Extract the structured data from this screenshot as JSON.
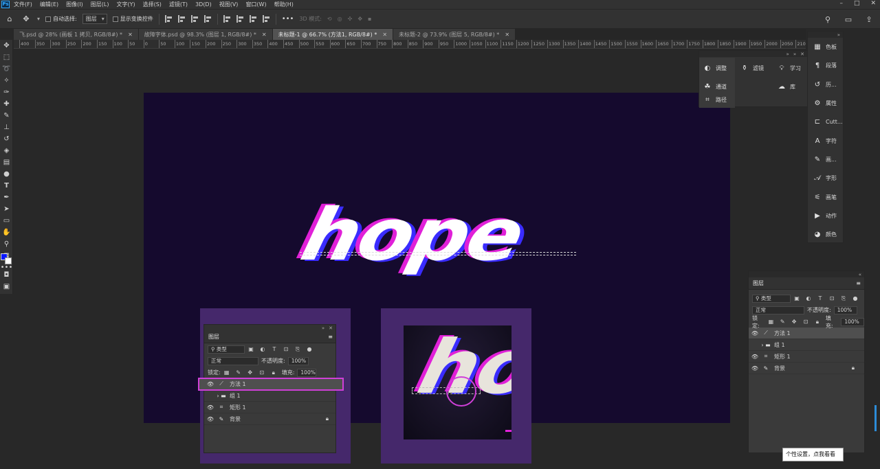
{
  "menubar": {
    "app_icon": "Ps",
    "items": [
      "文件(F)",
      "编辑(E)",
      "图像(I)",
      "图层(L)",
      "文字(Y)",
      "选择(S)",
      "滤镜(T)",
      "3D(D)",
      "视图(V)",
      "窗口(W)",
      "帮助(H)"
    ],
    "window_buttons": [
      "–",
      "□",
      "✕"
    ]
  },
  "options_bar": {
    "auto_select_label": "自动选择:",
    "auto_select_value": "图层",
    "show_transform_label": "显示变换控件",
    "mode_3d_label": "3D 模式:",
    "more": "•••"
  },
  "tabs": [
    {
      "label": "飞.psd @ 28% (画板 1 拷贝, RGB/8#) *",
      "active": false
    },
    {
      "label": "故障字体.psd @ 98.3% (图层 1, RGB/8#) *",
      "active": false
    },
    {
      "label": "未标题-1 @ 66.7% (方法1, RGB/8#) *",
      "active": true
    },
    {
      "label": "未标题-2 @ 73.9% (图层 5, RGB/8#) *",
      "active": false
    }
  ],
  "ruler_ticks": [
    "400",
    "350",
    "300",
    "250",
    "200",
    "150",
    "100",
    "50",
    "0",
    "50",
    "100",
    "150",
    "200",
    "250",
    "300",
    "350",
    "400",
    "450",
    "500",
    "550",
    "600",
    "650",
    "700",
    "750",
    "800",
    "850",
    "900",
    "950",
    "1000",
    "1050",
    "1100",
    "1150",
    "1200",
    "1250",
    "1300",
    "1350",
    "1400",
    "1450",
    "1500",
    "1550",
    "1600",
    "1650",
    "1700",
    "1750",
    "1800",
    "1850",
    "1900",
    "1950",
    "2000",
    "2050",
    "2100"
  ],
  "canvas": {
    "artboard_color": "#150a2e",
    "headline": "hope",
    "colors": {
      "main": "#ffffff",
      "glitch_magenta": "#e020d8",
      "glitch_blue": "#3a2cff"
    }
  },
  "float_panel_left": {
    "items": [
      {
        "icon": "adjustments-icon",
        "label": "调整"
      },
      {
        "icon": "filter-icon",
        "label": "滤镜"
      },
      {
        "icon": "bulb-icon",
        "label": "学习"
      },
      {
        "icon": "channels-icon",
        "label": "通道"
      },
      {
        "icon": "library-icon",
        "label": "库"
      },
      {
        "icon": "paths-icon",
        "label": "路径"
      }
    ]
  },
  "float_panel_right": {
    "items": [
      {
        "icon": "swatches-icon",
        "label": "色板"
      },
      {
        "icon": "paragraph-icon",
        "label": "段落"
      },
      {
        "icon": "history-icon",
        "label": "历..."
      },
      {
        "icon": "properties-icon",
        "label": "属性"
      },
      {
        "icon": "crop-icon",
        "label": "Cutt..."
      },
      {
        "icon": "character-icon",
        "label": "字符"
      },
      {
        "icon": "brush-preset-icon",
        "label": "画..."
      },
      {
        "icon": "glyphs-icon",
        "label": "字形"
      },
      {
        "icon": "brush-settings-icon",
        "label": "画笔"
      },
      {
        "icon": "actions-icon",
        "label": "动作"
      },
      {
        "icon": "color-icon",
        "label": "颜色"
      }
    ]
  },
  "layers_panel": {
    "title": "图层",
    "filter_type": "类型",
    "blend_mode": "正常",
    "opacity_label": "不透明度:",
    "opacity_value": "100%",
    "lock_label": "锁定:",
    "fill_label": "填充:",
    "fill_value": "100%",
    "layers": [
      {
        "name": "方法 1",
        "type": "pen",
        "visible": true,
        "selected": true
      },
      {
        "name": "组 1",
        "type": "group",
        "visible": false,
        "selected": false
      },
      {
        "name": "矩形 1",
        "type": "shape",
        "visible": true,
        "selected": false
      },
      {
        "name": "背景",
        "type": "brush",
        "visible": true,
        "selected": false,
        "locked": true
      }
    ]
  },
  "mini_layers_panel": {
    "title": "图层",
    "filter_type": "类型",
    "blend_mode": "正常",
    "opacity_label": "不透明度:",
    "opacity_value": "100%",
    "lock_label": "锁定:",
    "fill_label": "填充:",
    "fill_value": "100%",
    "layers": [
      "方法 1",
      "组 1",
      "矩形 1",
      "背景"
    ]
  },
  "mini_preview": {
    "headline": "ho"
  },
  "tooltip": "个性设置，点我看看"
}
